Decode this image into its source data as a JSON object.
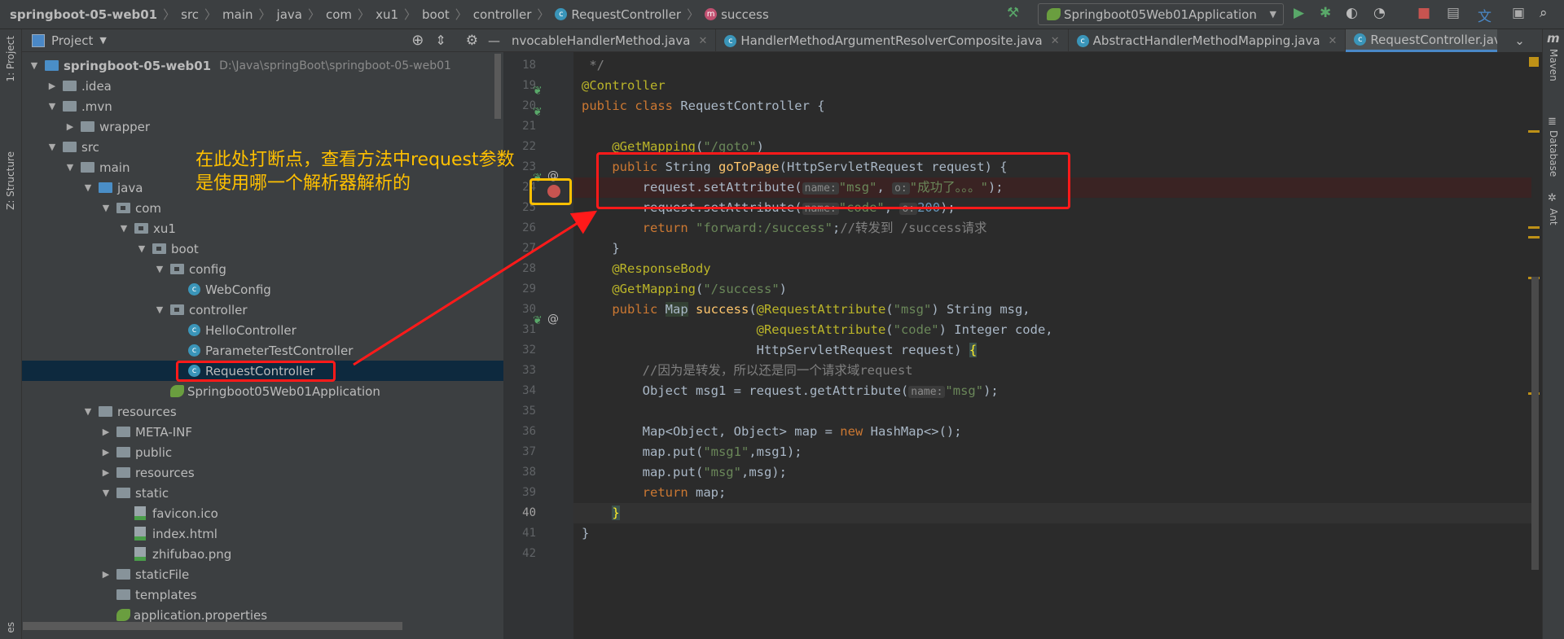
{
  "breadcrumb": [
    "springboot-05-web01",
    "src",
    "main",
    "java",
    "com",
    "xu1",
    "boot",
    "controller",
    "RequestController",
    "success"
  ],
  "run_config": "Springboot05Web01Application",
  "left_strip": {
    "project": "1: Project",
    "structure": "Z: Structure",
    "bottom": "es"
  },
  "right_strip": {
    "maven": "Maven",
    "database": "Database",
    "ant": "Ant"
  },
  "project_panel": {
    "title": "Project",
    "tree": [
      {
        "label": "springboot-05-web01",
        "depth": 0,
        "arrow": "down",
        "icon": "module",
        "path": "D:\\Java\\springBoot\\springboot-05-web01"
      },
      {
        "label": ".idea",
        "depth": 1,
        "arrow": "right",
        "icon": "folder"
      },
      {
        "label": ".mvn",
        "depth": 1,
        "arrow": "down",
        "icon": "folder"
      },
      {
        "label": "wrapper",
        "depth": 2,
        "arrow": "right",
        "icon": "folder"
      },
      {
        "label": "src",
        "depth": 1,
        "arrow": "down",
        "icon": "folder"
      },
      {
        "label": "main",
        "depth": 2,
        "arrow": "down",
        "icon": "folder"
      },
      {
        "label": "java",
        "depth": 3,
        "arrow": "down",
        "icon": "folder-blue"
      },
      {
        "label": "com",
        "depth": 4,
        "arrow": "down",
        "icon": "package"
      },
      {
        "label": "xu1",
        "depth": 5,
        "arrow": "down",
        "icon": "package"
      },
      {
        "label": "boot",
        "depth": 6,
        "arrow": "down",
        "icon": "package"
      },
      {
        "label": "config",
        "depth": 7,
        "arrow": "down",
        "icon": "package"
      },
      {
        "label": "WebConfig",
        "depth": 8,
        "arrow": "",
        "icon": "class"
      },
      {
        "label": "controller",
        "depth": 7,
        "arrow": "down",
        "icon": "package"
      },
      {
        "label": "HelloController",
        "depth": 8,
        "arrow": "",
        "icon": "class"
      },
      {
        "label": "ParameterTestController",
        "depth": 8,
        "arrow": "",
        "icon": "class"
      },
      {
        "label": "RequestController",
        "depth": 8,
        "arrow": "",
        "icon": "class",
        "selected": true
      },
      {
        "label": "Springboot05Web01Application",
        "depth": 7,
        "arrow": "",
        "icon": "spring-class"
      },
      {
        "label": "resources",
        "depth": 3,
        "arrow": "down",
        "icon": "folder"
      },
      {
        "label": "META-INF",
        "depth": 4,
        "arrow": "right",
        "icon": "folder"
      },
      {
        "label": "public",
        "depth": 4,
        "arrow": "right",
        "icon": "folder"
      },
      {
        "label": "resources",
        "depth": 4,
        "arrow": "right",
        "icon": "folder"
      },
      {
        "label": "static",
        "depth": 4,
        "arrow": "down",
        "icon": "folder"
      },
      {
        "label": "favicon.ico",
        "depth": 5,
        "arrow": "",
        "icon": "image"
      },
      {
        "label": "index.html",
        "depth": 5,
        "arrow": "",
        "icon": "html"
      },
      {
        "label": "zhifubao.png",
        "depth": 5,
        "arrow": "",
        "icon": "image"
      },
      {
        "label": "staticFile",
        "depth": 4,
        "arrow": "right",
        "icon": "folder"
      },
      {
        "label": "templates",
        "depth": 4,
        "arrow": "",
        "icon": "folder"
      },
      {
        "label": "application.properties",
        "depth": 4,
        "arrow": "",
        "icon": "spring-file"
      }
    ]
  },
  "tabs": [
    {
      "label": "nvocableHandlerMethod.java",
      "icon": "c",
      "active": false
    },
    {
      "label": "HandlerMethodArgumentResolverComposite.java",
      "icon": "c",
      "active": false
    },
    {
      "label": "AbstractHandlerMethodMapping.java",
      "icon": "c",
      "active": false
    },
    {
      "label": "RequestController.java",
      "icon": "c",
      "active": true
    }
  ],
  "code": [
    {
      "n": 18,
      "t": [
        [
          " */",
          "cm"
        ]
      ]
    },
    {
      "n": 19,
      "t": [
        [
          "@Controller",
          "ann"
        ]
      ]
    },
    {
      "n": 20,
      "t": [
        [
          "public class ",
          "kw"
        ],
        [
          "RequestController {",
          ""
        ]
      ]
    },
    {
      "n": 21,
      "t": []
    },
    {
      "n": 22,
      "t": [
        [
          "    @GetMapping",
          "ann"
        ],
        [
          "(",
          ""
        ],
        [
          "\"/goto\"",
          "str"
        ],
        [
          ")",
          ""
        ]
      ]
    },
    {
      "n": 23,
      "t": [
        [
          "    public ",
          "kw"
        ],
        [
          "String ",
          ""
        ],
        [
          "goToPage",
          "fn"
        ],
        [
          "(HttpServletRequest request) {",
          ""
        ]
      ]
    },
    {
      "n": 24,
      "bp": true,
      "t": [
        [
          "        request.setAttribute(",
          ""
        ],
        [
          "name:",
          "hint"
        ],
        [
          "\"msg\"",
          "str"
        ],
        [
          ", ",
          ""
        ],
        [
          "o:",
          "hint"
        ],
        [
          "\"成功了。。。\"",
          "str"
        ],
        [
          ");",
          ""
        ]
      ]
    },
    {
      "n": 25,
      "t": [
        [
          "        request.setAttribute(",
          ""
        ],
        [
          "name:",
          "hint"
        ],
        [
          "\"code\"",
          "str"
        ],
        [
          ", ",
          ""
        ],
        [
          "o:",
          "hint"
        ],
        [
          "200",
          "num"
        ],
        [
          ");",
          ""
        ]
      ]
    },
    {
      "n": 26,
      "t": [
        [
          "        return ",
          "kw"
        ],
        [
          "\"forward:/success\"",
          "str"
        ],
        [
          ";",
          ""
        ],
        [
          "//转发到 /success请求",
          "cm"
        ]
      ]
    },
    {
      "n": 27,
      "t": [
        [
          "    }",
          ""
        ]
      ]
    },
    {
      "n": 28,
      "t": [
        [
          "    @ResponseBody",
          "ann"
        ]
      ]
    },
    {
      "n": 29,
      "t": [
        [
          "    @GetMapping",
          "ann"
        ],
        [
          "(",
          ""
        ],
        [
          "\"/success\"",
          "str"
        ],
        [
          ")",
          ""
        ]
      ]
    },
    {
      "n": 30,
      "t": [
        [
          "    public ",
          "kw"
        ],
        [
          "Map",
          "hl"
        ],
        [
          " ",
          ""
        ],
        [
          "success",
          "fn"
        ],
        [
          "(",
          ""
        ],
        [
          "@RequestAttribute",
          "ann"
        ],
        [
          "(",
          ""
        ],
        [
          "\"msg\"",
          "str"
        ],
        [
          ") String msg,",
          ""
        ]
      ]
    },
    {
      "n": 31,
      "t": [
        [
          "                       @RequestAttribute",
          "ann"
        ],
        [
          "(",
          ""
        ],
        [
          "\"code\"",
          "str"
        ],
        [
          ") Integer code,",
          ""
        ]
      ]
    },
    {
      "n": 32,
      "t": [
        [
          "                       HttpServletRequest request) ",
          ""
        ],
        [
          "{",
          "brace"
        ]
      ]
    },
    {
      "n": 33,
      "t": [
        [
          "        //因为是转发，所以还是同一个请求域request",
          "cm"
        ]
      ]
    },
    {
      "n": 34,
      "t": [
        [
          "        Object msg1 = request.getAttribute(",
          ""
        ],
        [
          "name:",
          "hint"
        ],
        [
          "\"msg\"",
          "str"
        ],
        [
          ");",
          ""
        ]
      ]
    },
    {
      "n": 35,
      "t": []
    },
    {
      "n": 36,
      "t": [
        [
          "        Map<Object, Object> map = ",
          ""
        ],
        [
          "new ",
          "kw"
        ],
        [
          "HashMap<>();",
          ""
        ]
      ]
    },
    {
      "n": 37,
      "t": [
        [
          "        map.put(",
          ""
        ],
        [
          "\"msg1\"",
          "str"
        ],
        [
          ",msg1);",
          ""
        ]
      ]
    },
    {
      "n": 38,
      "t": [
        [
          "        map.put(",
          ""
        ],
        [
          "\"msg\"",
          "str"
        ],
        [
          ",msg);",
          ""
        ]
      ]
    },
    {
      "n": 39,
      "t": [
        [
          "        return ",
          "kw"
        ],
        [
          "map;",
          ""
        ]
      ]
    },
    {
      "n": 40,
      "cur": true,
      "t": [
        [
          "    ",
          ""
        ],
        [
          "}",
          "brace"
        ]
      ]
    },
    {
      "n": 41,
      "t": [
        [
          "}",
          ""
        ]
      ]
    },
    {
      "n": 42,
      "t": []
    }
  ],
  "annotation": {
    "line1": "在此处打断点，查看方法中request参数",
    "line2": "是使用哪一个解析器解析的",
    "color": "#ffc000",
    "box_color": "#ff1a1a"
  }
}
